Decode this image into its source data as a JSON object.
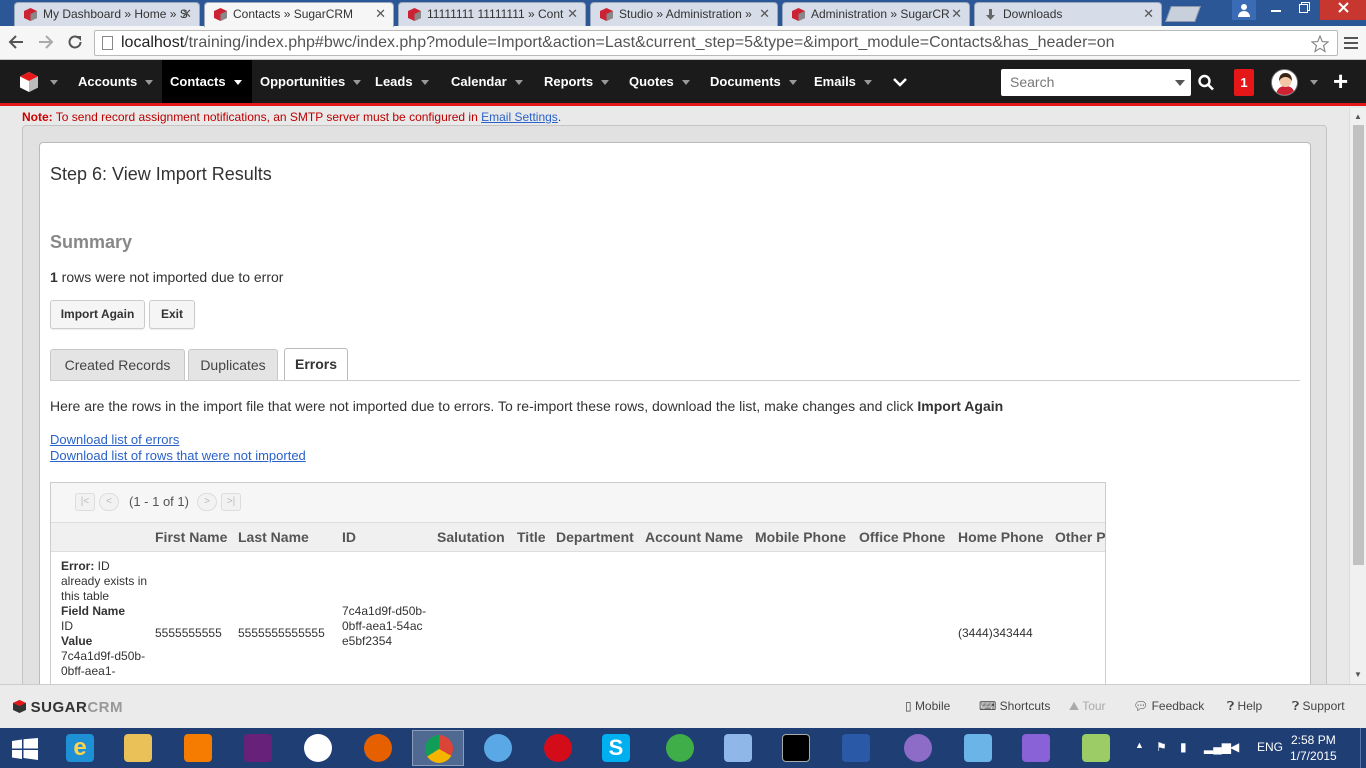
{
  "browser": {
    "tabs": [
      {
        "title": "My Dashboard » Home » S"
      },
      {
        "title": "Contacts » SugarCRM"
      },
      {
        "title": "11111111 11111111 » Cont"
      },
      {
        "title": "Studio » Administration »"
      },
      {
        "title": "Administration » SugarCR"
      },
      {
        "title": "Downloads"
      }
    ],
    "close_glyph": "✕",
    "url_host": "localhost",
    "url_path": "/training/index.php#bwc/index.php?module=Import&action=Last&current_step=5&type=&import_module=Contacts&has_header=on"
  },
  "nav": {
    "items": [
      "Accounts",
      "Contacts",
      "Opportunities",
      "Leads",
      "Calendar",
      "Reports",
      "Quotes",
      "Documents",
      "Emails"
    ],
    "active": "Contacts",
    "search_placeholder": "Search",
    "notification_count": "1",
    "plus": "+"
  },
  "note": {
    "label": "Note:",
    "text": " To send record assignment notifications, an SMTP server must be configured in ",
    "link": "Email Settings",
    "end": "."
  },
  "import": {
    "step_title": "Step 6: View Import Results",
    "summary_heading": "Summary",
    "error_count": "1",
    "error_text": " rows were not imported due to error",
    "buttons": {
      "import_again": "Import Again",
      "exit": "Exit"
    },
    "tabs": [
      "Created Records",
      "Duplicates",
      "Errors"
    ],
    "selected_tab": "Errors",
    "errors_description": "Here are the rows in the import file that were not imported due to errors. To re-import these rows, download the list, make changes and click ",
    "errors_description_bold": "Import Again",
    "download_errors": "Download list of errors",
    "download_rows": "Download list of rows that were not imported"
  },
  "table": {
    "pagination": "(1 - 1 of 1)",
    "columns": [
      "First Name",
      "Last Name",
      "ID",
      "Salutation",
      "Title",
      "Department",
      "Account Name",
      "Mobile Phone",
      "Office Phone",
      "Home Phone",
      "Other P"
    ],
    "row": {
      "error_label": "Error:",
      "error_text": " ID already exists in this table",
      "field_name_label": "Field Name",
      "field_name_value": "ID",
      "value_label": "Value",
      "value_value": "7c4a1d9f-d50b-0bff-aea1-",
      "first_name": "5555555555",
      "last_name": "5555555555555",
      "id": "7c4a1d9f-d50b-0bff-aea1-54ace5bf2354",
      "home_phone": "(3444)343444"
    }
  },
  "footer": {
    "logo_sugar": "SUGAR",
    "logo_crm": "CRM",
    "items": [
      "Mobile",
      "Shortcuts",
      "Tour",
      "Feedback",
      "Help",
      "Support"
    ]
  },
  "taskbar": {
    "lang": "ENG",
    "time": "2:58 PM",
    "date": "1/7/2015"
  }
}
